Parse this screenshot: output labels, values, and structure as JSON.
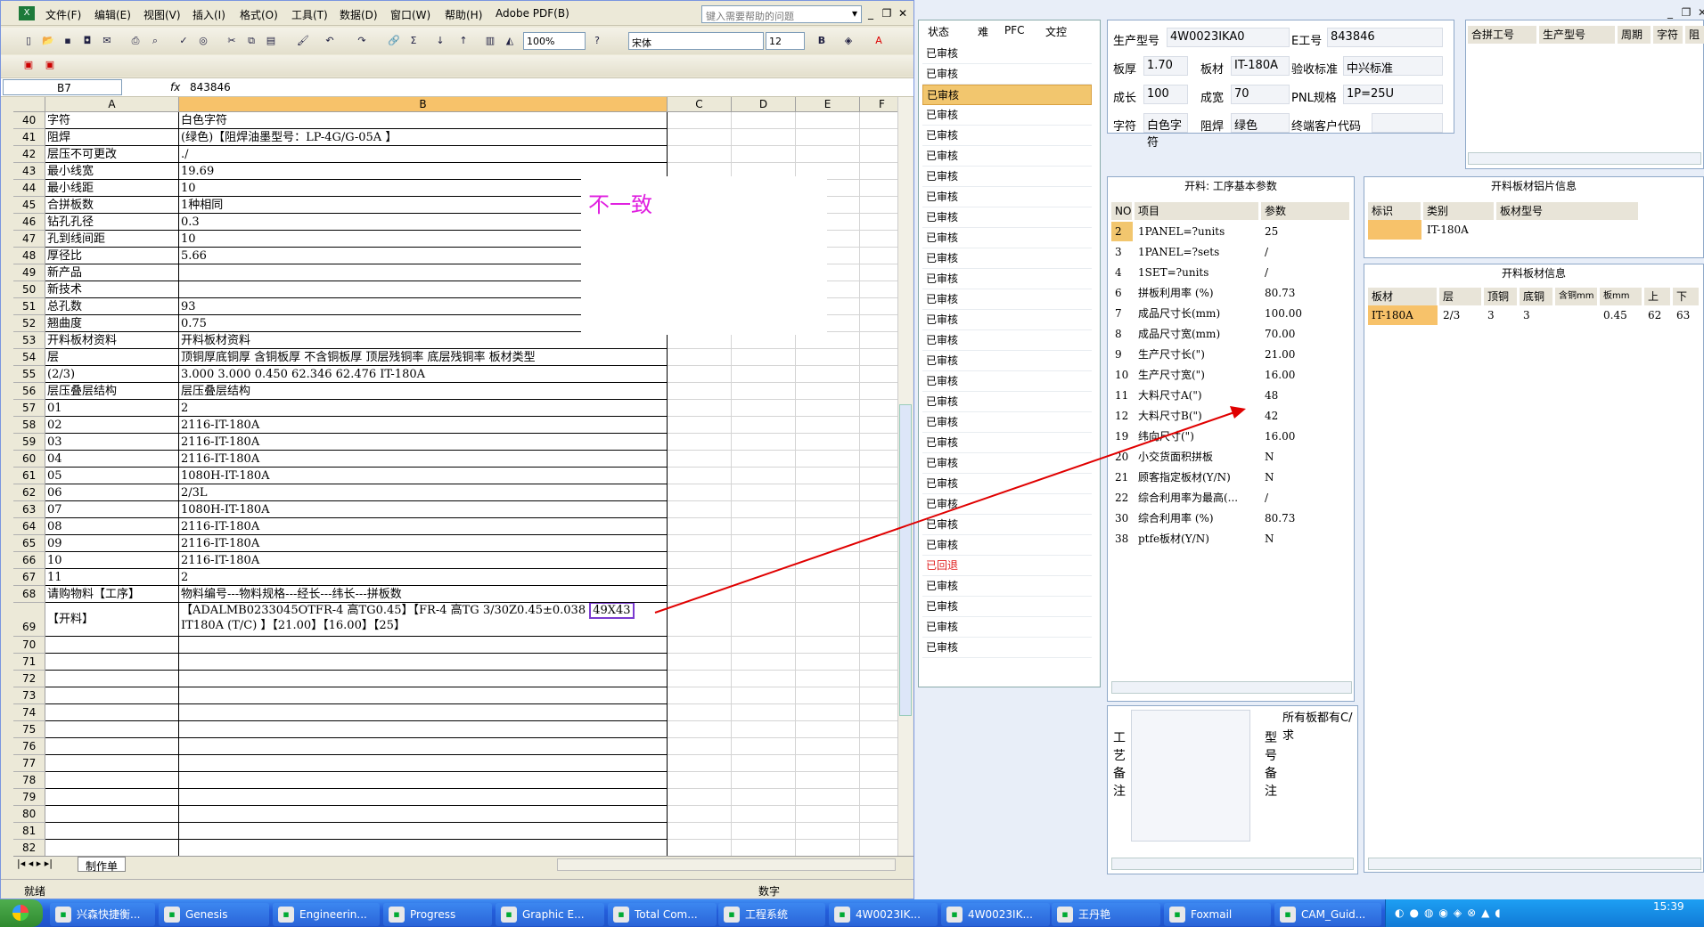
{
  "excel": {
    "menu": [
      "文件(F)",
      "编辑(E)",
      "视图(V)",
      "插入(I)",
      "格式(O)",
      "工具(T)",
      "数据(D)",
      "窗口(W)",
      "帮助(H)",
      "Adobe PDF(B)"
    ],
    "help_placeholder": "键入需要帮助的问题",
    "zoom": "100%",
    "font": "宋体",
    "font_size": "12",
    "name_box": "B7",
    "fx": "fx",
    "formula_value": "843846",
    "columns": [
      "A",
      "B",
      "C",
      "D",
      "E",
      "F"
    ],
    "rows": [
      {
        "n": "40",
        "a": "字符",
        "b": "白色字符"
      },
      {
        "n": "41",
        "a": "阻焊",
        "b": "(绿色)【阻焊油墨型号：LP-4G/G-05A 】"
      },
      {
        "n": "42",
        "a": "层压不可更改",
        "b": "./"
      },
      {
        "n": "43",
        "a": "最小线宽",
        "b": "19.69"
      },
      {
        "n": "44",
        "a": "最小线距",
        "b": "10"
      },
      {
        "n": "45",
        "a": "合拼板数",
        "b": "1种相同"
      },
      {
        "n": "46",
        "a": "钻孔孔径",
        "b": "0.3"
      },
      {
        "n": "47",
        "a": "孔到线间距",
        "b": "10"
      },
      {
        "n": "48",
        "a": "厚径比",
        "b": "5.66"
      },
      {
        "n": "49",
        "a": "新产品",
        "b": ""
      },
      {
        "n": "50",
        "a": "新技术",
        "b": ""
      },
      {
        "n": "51",
        "a": "总孔数",
        "b": "93"
      },
      {
        "n": "52",
        "a": "翘曲度",
        "b": "0.75"
      },
      {
        "n": "53",
        "a": "开料板材资料",
        "b": "开料板材资料"
      },
      {
        "n": "54",
        "a": "层",
        "b": "顶铜厚底铜厚 含铜板厚 不含铜板厚 顶层残铜率 底层残铜率 板材类型"
      },
      {
        "n": "55",
        "a": "(2/3)",
        "b": "3.000  3.000          0.450        62.346      62.476        IT-180A"
      },
      {
        "n": "56",
        "a": "层压叠层结构",
        "b": "层压叠层结构"
      },
      {
        "n": "57",
        "a": "01",
        "b": "2"
      },
      {
        "n": "58",
        "a": "02",
        "b": "2116-IT-180A"
      },
      {
        "n": "59",
        "a": "03",
        "b": "2116-IT-180A"
      },
      {
        "n": "60",
        "a": "04",
        "b": "2116-IT-180A"
      },
      {
        "n": "61",
        "a": "05",
        "b": "1080H-IT-180A"
      },
      {
        "n": "62",
        "a": "06",
        "b": "2/3L"
      },
      {
        "n": "63",
        "a": "07",
        "b": "1080H-IT-180A"
      },
      {
        "n": "64",
        "a": "08",
        "b": "2116-IT-180A"
      },
      {
        "n": "65",
        "a": "09",
        "b": "2116-IT-180A"
      },
      {
        "n": "66",
        "a": "10",
        "b": "2116-IT-180A"
      },
      {
        "n": "67",
        "a": "11",
        "b": "2"
      },
      {
        "n": "68",
        "a": "请购物料【工序】",
        "b": "物料编号---物料规格---经长---纬长---拼板数"
      }
    ],
    "row69": {
      "n": "69",
      "a": "【开料】",
      "b1": "【ADALMB0233045OTFR-4 高TG0.45】【FR-4 高TG 3/30Z0.45±0.038 ",
      "b1_box": "49X43",
      "b2": "IT180A (T/C)  】【21.00】【16.00】【25】"
    },
    "empty_rows": [
      "70",
      "71",
      "72",
      "73",
      "74",
      "75",
      "76",
      "77",
      "78",
      "79",
      "80",
      "81",
      "82"
    ],
    "annotation": "不一致",
    "sheet_tab": "制作单",
    "status_left": "就绪",
    "status_mid": "数字"
  },
  "status_list": {
    "headers": [
      "状态",
      "难",
      "PFC",
      "文控"
    ],
    "items": [
      "已审核",
      "已审核",
      "已审核",
      "已审核",
      "已审核",
      "已审核",
      "已审核",
      "已审核",
      "已审核",
      "已审核",
      "已审核",
      "已审核",
      "已审核",
      "已审核",
      "已审核",
      "已审核",
      "已审核",
      "已审核",
      "已审核",
      "已审核",
      "已审核",
      "已审核",
      "已审核",
      "已审核",
      "已审核",
      "已回退",
      "已审核",
      "已审核",
      "已审核",
      "已审核"
    ],
    "selected_index": 2
  },
  "info": {
    "fields": [
      {
        "label": "生产型号",
        "value": "4W0023IKA0"
      },
      {
        "label": "E工号",
        "value": "843846"
      },
      {
        "label": "板厚",
        "value": "1.70"
      },
      {
        "label": "板材",
        "value": "IT-180A"
      },
      {
        "label": "验收标准",
        "value": "中兴标准"
      },
      {
        "label": "成长",
        "value": "100"
      },
      {
        "label": "成宽",
        "value": "70"
      },
      {
        "label": "PNL规格",
        "value": "1P=25U"
      },
      {
        "label": "字符",
        "value": "白色字符"
      },
      {
        "label": "阻焊",
        "value": "绿色"
      },
      {
        "label": "终端客户代码",
        "value": ""
      }
    ]
  },
  "merge_table": {
    "headers": [
      "合拼工号",
      "生产型号",
      "周期",
      "字符",
      "阻焊"
    ]
  },
  "process": {
    "title": "开料: 工序基本参数",
    "headers": [
      "NO",
      "项目",
      "参数"
    ],
    "rows": [
      {
        "no": "2",
        "item": "1PANEL=?units",
        "val": "25"
      },
      {
        "no": "3",
        "item": "1PANEL=?sets",
        "val": "/"
      },
      {
        "no": "4",
        "item": "1SET=?units",
        "val": "/"
      },
      {
        "no": "6",
        "item": "拼板利用率 (%)",
        "val": "80.73"
      },
      {
        "no": "7",
        "item": "成品尺寸长(mm)",
        "val": "100.00"
      },
      {
        "no": "8",
        "item": "成品尺寸宽(mm)",
        "val": "70.00"
      },
      {
        "no": "9",
        "item": "生产尺寸长(\")",
        "val": "21.00"
      },
      {
        "no": "10",
        "item": "生产尺寸宽(\")",
        "val": "16.00"
      },
      {
        "no": "11",
        "item": "大料尺寸A(\")",
        "val": "48"
      },
      {
        "no": "12",
        "item": "大料尺寸B(\")",
        "val": "42"
      },
      {
        "no": "19",
        "item": "纬向尺寸(\")",
        "val": "16.00"
      },
      {
        "no": "20",
        "item": "小交货面积拼板",
        "val": "N"
      },
      {
        "no": "21",
        "item": "顾客指定板材(Y/N)",
        "val": "N"
      },
      {
        "no": "22",
        "item": "综合利用率为最高(...",
        "val": "/"
      },
      {
        "no": "30",
        "item": "综合利用率 (%)",
        "val": "80.73"
      },
      {
        "no": "38",
        "item": "ptfe板材(Y/N)",
        "val": "N"
      }
    ]
  },
  "photo_info": {
    "title": "开料板材铝片信息",
    "headers": [
      "标识",
      "类别",
      "板材型号"
    ],
    "row": {
      "mark": "",
      "type": "IT-180A",
      "model": ""
    }
  },
  "board_info": {
    "title": "开料板材信息",
    "headers": [
      "板材",
      "层",
      "顶铜",
      "底铜",
      "含铜mm",
      "板mm",
      "上",
      "下"
    ],
    "row": [
      "IT-180A",
      "2/3",
      "3",
      "3",
      "",
      "0.45",
      "62",
      "63"
    ]
  },
  "notes": {
    "craft_label": "工艺备注",
    "model_label": "型号备注",
    "model_text": "所有板都有C/求"
  },
  "taskbar": {
    "tasks": [
      "兴森快捷衡...",
      "Genesis",
      "Engineerin...",
      "Progress",
      "Graphic E...",
      "Total Com...",
      "工程系统",
      "4W0023IK...",
      "4W0023IK...",
      "王丹艳",
      "Foxmail",
      "CAM_Guid..."
    ],
    "clock": "15:39"
  },
  "colors": {
    "accent": "#f2c66e",
    "arrow": "#e00000",
    "annotation": "#e020e0",
    "returned": "#e02020"
  }
}
